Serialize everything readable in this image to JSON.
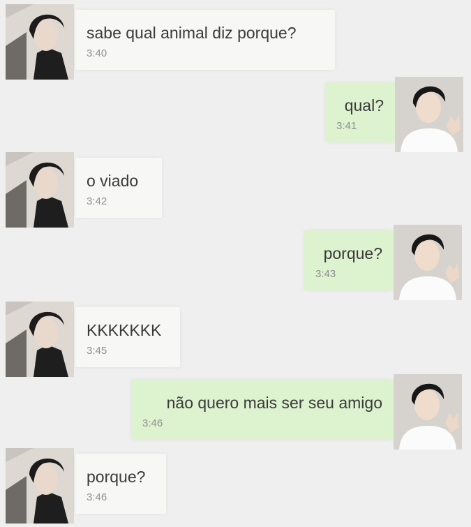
{
  "messages": [
    {
      "side": "in",
      "text": "sabe qual animal diz porque?",
      "time": "3:40"
    },
    {
      "side": "out",
      "text": "qual?",
      "time": "3:41"
    },
    {
      "side": "in",
      "text": "o viado",
      "time": "3:42"
    },
    {
      "side": "out",
      "text": "porque?",
      "time": "3:43"
    },
    {
      "side": "in",
      "text": "KKKKKKK",
      "time": "3:45"
    },
    {
      "side": "out",
      "text": "não quero mais ser seu amigo",
      "time": "3:46"
    },
    {
      "side": "in",
      "text": "porque?",
      "time": "3:46"
    }
  ],
  "colors": {
    "background": "#efefef",
    "incoming_bubble": "#f7f8f5",
    "outgoing_bubble": "#ddf2cf",
    "text": "#3a3a3a",
    "time": "#8f8f8f"
  }
}
